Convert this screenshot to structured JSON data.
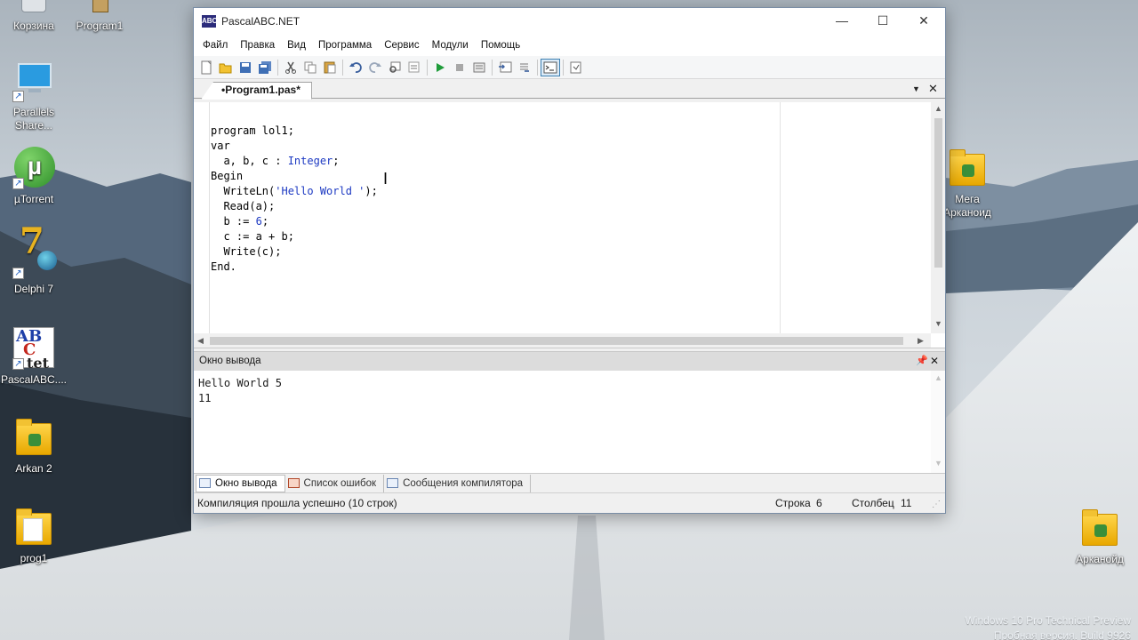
{
  "desktop": {
    "icons_left": [
      {
        "label": "Корзина",
        "name": "recycle-bin-icon"
      },
      {
        "label": "Program1",
        "name": "program1-icon"
      },
      {
        "label": "Parallels Share...",
        "name": "parallels-share-icon"
      },
      {
        "label": "µTorrent",
        "name": "utorrent-icon"
      },
      {
        "label": "Delphi 7",
        "name": "delphi7-icon"
      },
      {
        "label": "PascalABC....",
        "name": "pascalabc-icon"
      },
      {
        "label": "Arkan 2",
        "name": "arkan2-icon"
      },
      {
        "label": "prog1",
        "name": "prog1-icon"
      }
    ],
    "icons_right": [
      {
        "label_line1": "Мега",
        "label_line2": "Арканоид",
        "name": "mega-arkanoid-icon"
      },
      {
        "label": "Арканойд",
        "name": "arkanoid-icon"
      }
    ],
    "watermark": {
      "line1": "Windows 10 Pro Technical Preview",
      "line2": "Пробная версия. Build 9926"
    }
  },
  "window": {
    "title": "PascalABC.NET",
    "app_icon_text": "ABC",
    "controls": {
      "minimize": "—",
      "maximize": "☐",
      "close": "✕"
    },
    "menu": [
      "Файл",
      "Правка",
      "Вид",
      "Программа",
      "Сервис",
      "Модули",
      "Помощь"
    ],
    "toolbar_icons": [
      "new-file-icon",
      "open-file-icon",
      "save-icon",
      "save-all-icon",
      "cut-icon",
      "copy-icon",
      "paste-icon",
      "undo-icon",
      "redo-icon",
      "find-icon",
      "replace-icon",
      "run-icon",
      "stop-icon",
      "compile-icon",
      "debug-step-icon",
      "debug-step-into-icon",
      "output-window-icon",
      "settings-icon"
    ],
    "editor_tab": {
      "label": "•Program1.pas*"
    },
    "code_lines": [
      "program lol1;",
      "var",
      "  a, b, c : Integer;",
      "Begin",
      "  WriteLn('Hello World ');",
      "  Read(a);",
      "  b := 6;",
      "  c := a + b;",
      "  Write(c);",
      "End."
    ],
    "output": {
      "title": "Окно вывода",
      "lines": [
        "Hello World 5",
        "11"
      ]
    },
    "bottom_tabs": [
      "Окно вывода",
      "Список ошибок",
      "Сообщения компилятора"
    ],
    "status": {
      "message": "Компиляция прошла успешно (10 строк)",
      "row_label": "Строка",
      "row_value": "6",
      "col_label": "Столбец",
      "col_value": "11"
    }
  },
  "colors": {
    "keyword": "#000000",
    "string": "#1c39c2",
    "number": "#1c39c2",
    "type": "#1c39c2",
    "window_border": "#7a8ea6"
  }
}
